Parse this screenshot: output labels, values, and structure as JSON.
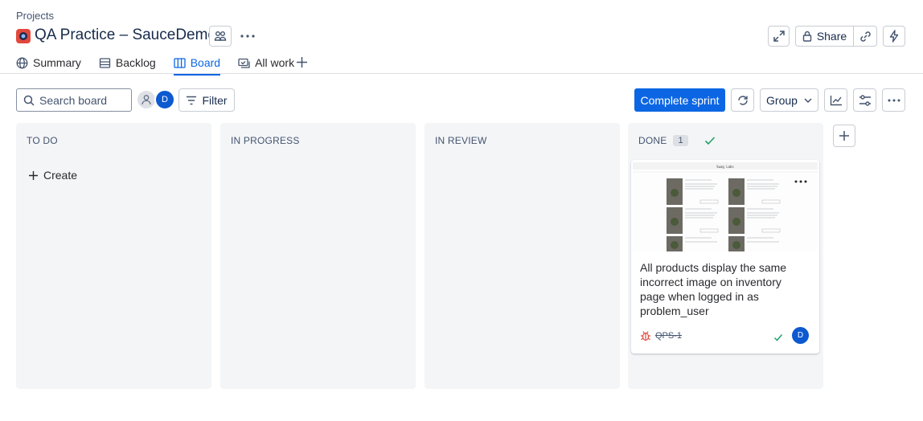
{
  "breadcrumb": "Projects",
  "project": {
    "title": "QA Practice – SauceDemo"
  },
  "header": {
    "share_label": "Share"
  },
  "tabs": [
    {
      "label": "Summary",
      "icon": "globe-icon"
    },
    {
      "label": "Backlog",
      "icon": "list-icon"
    },
    {
      "label": "Board",
      "icon": "board-icon",
      "active": true
    },
    {
      "label": "All work",
      "icon": "all-work-icon"
    }
  ],
  "toolbar": {
    "search_placeholder": "Search board",
    "avatar_initial": "D",
    "filter_label": "Filter",
    "complete_sprint_label": "Complete sprint",
    "group_label": "Group"
  },
  "columns": [
    {
      "title": "TO DO",
      "create_label": "Create"
    },
    {
      "title": "IN PROGRESS"
    },
    {
      "title": "IN REVIEW"
    },
    {
      "title": "DONE",
      "count": "1"
    }
  ],
  "card": {
    "summary": "All products display the same incorrect image on inventory page when logged in as problem_user",
    "key": "QPS-1",
    "assignee_initial": "D",
    "thumbnail_title": "Swag Labs"
  },
  "colors": {
    "accent": "#0c66e4",
    "done_check": "#22a06b",
    "bug": "#e2483d",
    "column_bg": "#f4f5f7"
  }
}
